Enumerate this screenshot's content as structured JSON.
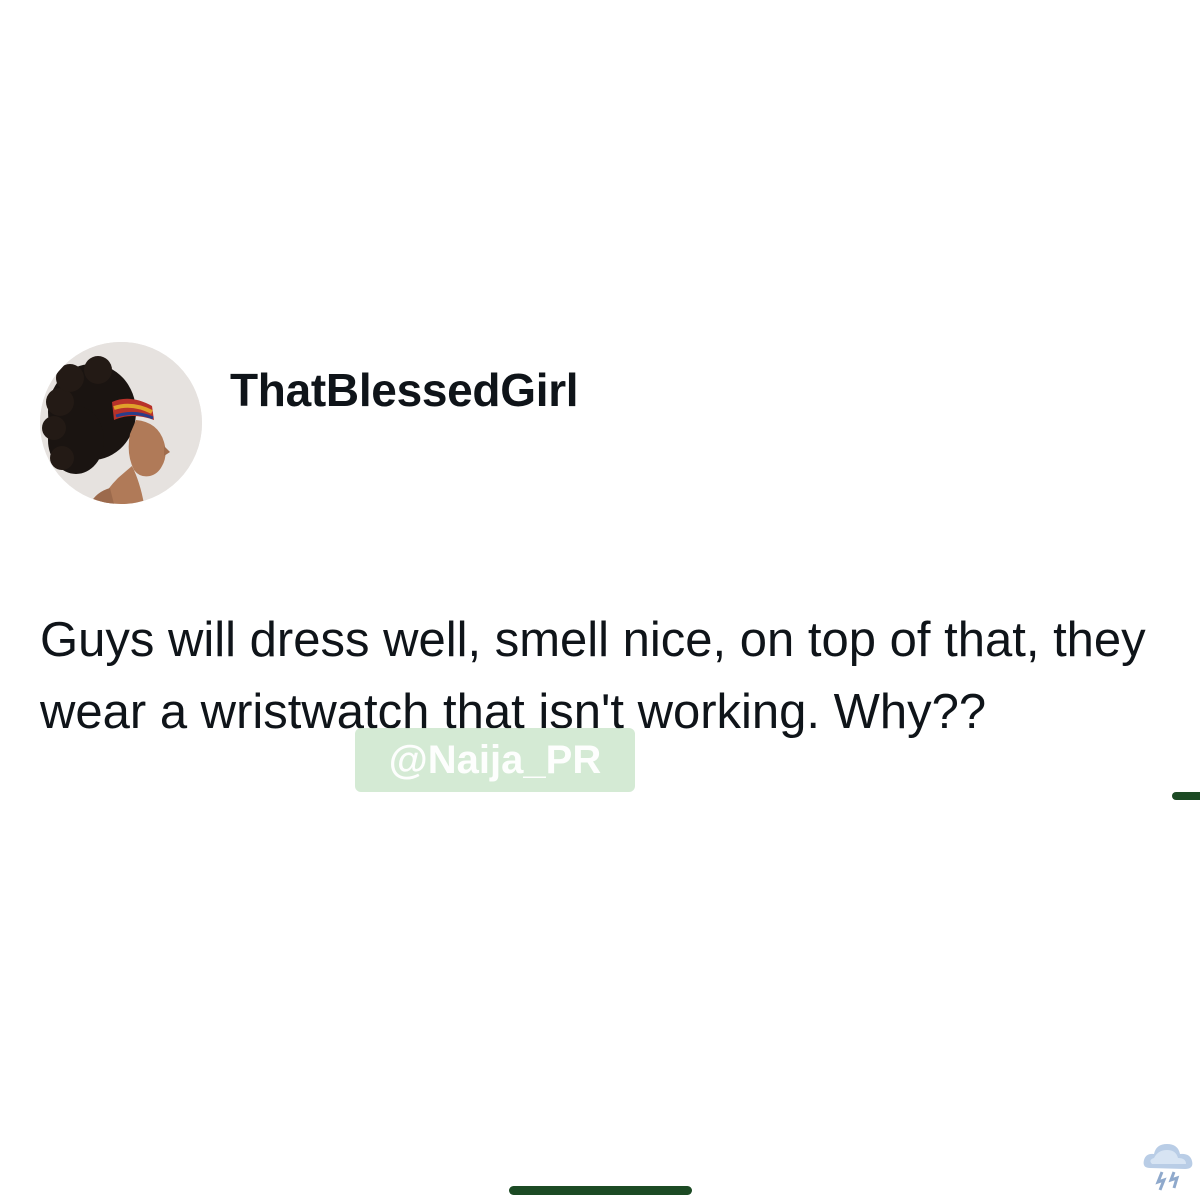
{
  "tweet": {
    "username": "ThatBlessedGirl",
    "text": "Guys will dress well, smell nice, on top of that, they wear a wristwatch that isn't working. Why??",
    "avatar": "profile-photo"
  },
  "watermark": {
    "text": "@Naija_PR"
  },
  "icons": {
    "corner_logo": "cloud-storm-icon"
  },
  "colors": {
    "text": "#0f1419",
    "background": "#ffffff",
    "accent": "#1c4a24",
    "watermark_bg": "#c4e2c4"
  }
}
